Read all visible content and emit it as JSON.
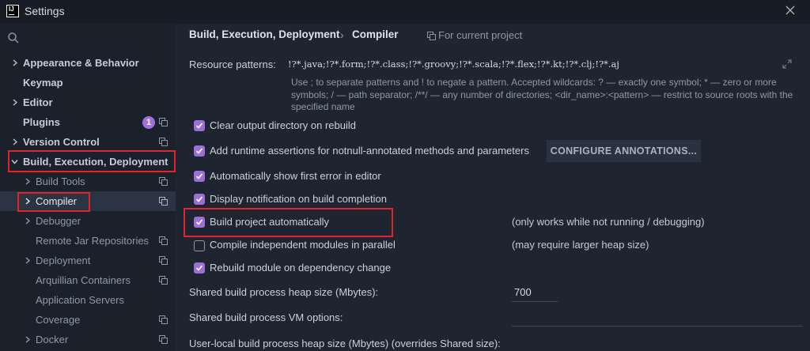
{
  "window": {
    "title": "Settings"
  },
  "sidebar": {
    "search_placeholder": "",
    "items": [
      {
        "label": "Appearance & Behavior"
      },
      {
        "label": "Keymap"
      },
      {
        "label": "Editor"
      },
      {
        "label": "Plugins",
        "badge": "1"
      },
      {
        "label": "Version Control"
      },
      {
        "label": "Build, Execution, Deployment"
      },
      {
        "label": "Build Tools"
      },
      {
        "label": "Compiler"
      },
      {
        "label": "Debugger"
      },
      {
        "label": "Remote Jar Repositories"
      },
      {
        "label": "Deployment"
      },
      {
        "label": "Arquillian Containers"
      },
      {
        "label": "Application Servers"
      },
      {
        "label": "Coverage"
      },
      {
        "label": "Docker"
      }
    ]
  },
  "breadcrumb": {
    "parent": "Build, Execution, Deployment",
    "separator": "›",
    "current": "Compiler",
    "scope": "For current project"
  },
  "resource_patterns": {
    "label": "Resource patterns:",
    "value": "!?*.java;!?*.form;!?*.class;!?*.groovy;!?*.scala;!?*.flex;!?*.kt;!?*.clj;!?*.aj",
    "hint": "Use ; to separate patterns and ! to negate a pattern. Accepted wildcards: ? — exactly one symbol; * — zero or more symbols; / — path separator; /**/ — any number of directories; <dir_name>:<pattern> — restrict to source roots with the specified name"
  },
  "options": [
    {
      "label": "Clear output directory on rebuild",
      "checked": true
    },
    {
      "label": "Add runtime assertions for notnull-annotated methods and parameters",
      "checked": true
    },
    {
      "label": "Automatically show first error in editor",
      "checked": true
    },
    {
      "label": "Display notification on build completion",
      "checked": true
    },
    {
      "label": "Build project automatically",
      "checked": true,
      "note": "(only works while not running / debugging)"
    },
    {
      "label": "Compile independent modules in parallel",
      "checked": false,
      "note": "(may require larger heap size)"
    },
    {
      "label": "Rebuild module on dependency change",
      "checked": true
    }
  ],
  "configure_button": "CONFIGURE ANNOTATIONS...",
  "fields": {
    "heap_label": "Shared build process heap size (Mbytes):",
    "heap_value": "700",
    "vm_label": "Shared build process VM options:",
    "vm_value": "",
    "user_heap_label": "User-local build process heap size (Mbytes) (overrides Shared size):"
  },
  "colors": {
    "accent": "#9b6fd6",
    "highlight": "#e0262c",
    "badge": "#a36fdc"
  },
  "icons": [
    "app-logo-icon",
    "close-icon",
    "search-icon",
    "chevron-right-icon",
    "chevron-down-icon",
    "project-scope-icon",
    "expand-icon",
    "checkmark-icon"
  ]
}
